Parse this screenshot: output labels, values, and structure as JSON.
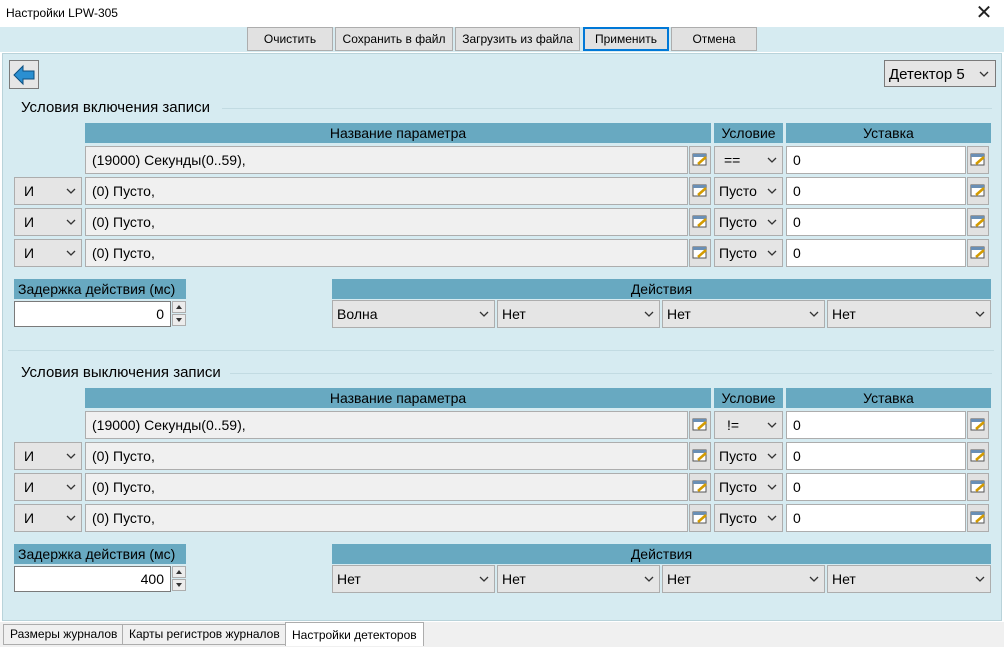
{
  "window": {
    "title": "Настройки LPW-305"
  },
  "toolbar": {
    "clear": "Очистить",
    "save": "Сохранить в файл",
    "load": "Загрузить из файла",
    "apply": "Применить",
    "cancel": "Отмена"
  },
  "detector": {
    "selected": "Детектор 5"
  },
  "on_group": {
    "title": "Условия включения записи",
    "header": {
      "param": "Название параметра",
      "condition": "Условие",
      "setpoint": "Уставка"
    },
    "rows": [
      {
        "logic": "",
        "param": "(19000) Секунды(0..59),",
        "condition": "==",
        "setpoint": "0"
      },
      {
        "logic": "И",
        "param": "(0) Пусто,",
        "condition": "Пусто",
        "setpoint": "0"
      },
      {
        "logic": "И",
        "param": "(0) Пусто,",
        "condition": "Пусто",
        "setpoint": "0"
      },
      {
        "logic": "И",
        "param": "(0) Пусто,",
        "condition": "Пусто",
        "setpoint": "0"
      }
    ],
    "delay_label": "Задержка действия (мс)",
    "delay_value": "0",
    "actions_label": "Действия",
    "actions": [
      "Волна",
      "Нет",
      "Нет",
      "Нет"
    ]
  },
  "off_group": {
    "title": "Условия выключения записи",
    "header": {
      "param": "Название параметра",
      "condition": "Условие",
      "setpoint": "Уставка"
    },
    "rows": [
      {
        "logic": "",
        "param": "(19000) Секунды(0..59),",
        "condition": "!=",
        "setpoint": "0"
      },
      {
        "logic": "И",
        "param": "(0) Пусто,",
        "condition": "Пусто",
        "setpoint": "0"
      },
      {
        "logic": "И",
        "param": "(0) Пусто,",
        "condition": "Пусто",
        "setpoint": "0"
      },
      {
        "logic": "И",
        "param": "(0) Пусто,",
        "condition": "Пусто",
        "setpoint": "0"
      }
    ],
    "delay_label": "Задержка действия (мс)",
    "delay_value": "400",
    "actions_label": "Действия",
    "actions": [
      "Нет",
      "Нет",
      "Нет",
      "Нет"
    ]
  },
  "tabs": [
    "Размеры журналов",
    "Карты регистров журналов",
    "Настройки детекторов"
  ],
  "colors": {
    "panel": "#d6ebf1",
    "header": "#68a9c1",
    "focus": "#0078d7"
  }
}
